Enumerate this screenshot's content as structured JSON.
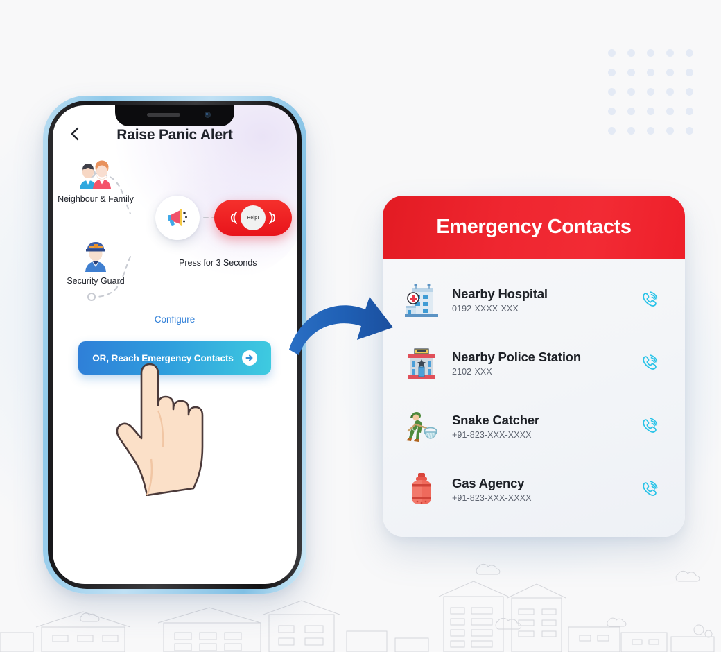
{
  "background": {
    "page_bg": "#f8f8f9",
    "dot_color": "#e4eaf5",
    "dot_grid_rows": 5,
    "dot_grid_cols": 5,
    "skyline_name": "city-skyline-line-art"
  },
  "phone": {
    "frame_color": "#8fc9ea",
    "app": {
      "back_icon": "chevron-left-icon",
      "title": "Raise Panic Alert",
      "nodes": [
        {
          "label": "Neighbour & Family",
          "icon": "family-avatars-icon"
        },
        {
          "label": "Security Guard",
          "icon": "security-guard-avatar-icon"
        }
      ],
      "center_icon": "megaphone-icon",
      "help_button": {
        "label": "Help!",
        "color": "#ee1f2a",
        "hint": "Press for 3 Seconds"
      },
      "configure_link": "Configure",
      "cta": {
        "label": "OR, Reach Emergency Contacts",
        "arrow_icon": "arrow-right-circle-icon",
        "gradient_from": "#2f7fd8",
        "gradient_to": "#3ecbe0"
      },
      "pointer_icon": "pointing-hand-cursor"
    }
  },
  "flow_arrow": {
    "icon": "curved-arrow-right-icon",
    "color": "#1f5fb4"
  },
  "contacts_card": {
    "header": {
      "title": "Emergency Contacts",
      "bg_from": "#e31b23",
      "bg_to": "#f22b34"
    },
    "call_icon": "phone-ringing-icon",
    "call_icon_color": "#29c3e8",
    "items": [
      {
        "name": "Nearby Hospital",
        "phone": "0192-XXXX-XXX",
        "icon": "hospital-building-icon"
      },
      {
        "name": "Nearby Police Station",
        "phone": "2102-XXX",
        "icon": "police-station-building-icon"
      },
      {
        "name": "Snake Catcher",
        "phone": "+91-823-XXX-XXXX",
        "icon": "snake-catcher-person-icon"
      },
      {
        "name": "Gas Agency",
        "phone": "+91-823-XXX-XXXX",
        "icon": "gas-cylinder-icon"
      }
    ]
  }
}
